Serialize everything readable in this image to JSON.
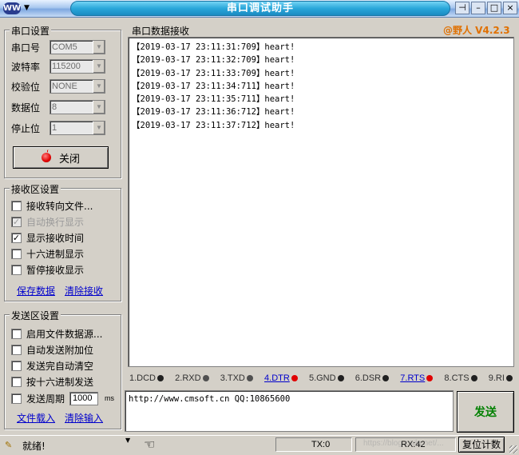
{
  "window": {
    "logo_text": "WW",
    "title": "串口调试助手",
    "buttons": {
      "pin": "⊣",
      "minimize": "–",
      "maximize": "□",
      "close": "×"
    }
  },
  "serial_settings": {
    "group_title": "串口设置",
    "fields": [
      {
        "label": "串口号",
        "value": "COM5"
      },
      {
        "label": "波特率",
        "value": "115200"
      },
      {
        "label": "校验位",
        "value": "NONE"
      },
      {
        "label": "数据位",
        "value": "8"
      },
      {
        "label": "停止位",
        "value": "1"
      }
    ],
    "close_button": "关闭"
  },
  "recv_settings": {
    "group_title": "接收区设置",
    "options": [
      {
        "label": "接收转向文件...",
        "checked": false,
        "disabled": false
      },
      {
        "label": "自动换行显示",
        "checked": true,
        "disabled": true
      },
      {
        "label": "显示接收时间",
        "checked": true,
        "disabled": false
      },
      {
        "label": "十六进制显示",
        "checked": false,
        "disabled": false
      },
      {
        "label": "暂停接收显示",
        "checked": false,
        "disabled": false
      }
    ],
    "save_link": "保存数据",
    "clear_link": "清除接收"
  },
  "send_settings": {
    "group_title": "发送区设置",
    "options": [
      {
        "label": "启用文件数据源...",
        "checked": false
      },
      {
        "label": "自动发送附加位",
        "checked": false
      },
      {
        "label": "发送完自动清空",
        "checked": false
      },
      {
        "label": "按十六进制发送",
        "checked": false
      }
    ],
    "period_label": "发送周期",
    "period_value": "1000",
    "period_unit": "ms",
    "load_link": "文件载入",
    "clear_link": "清除输入"
  },
  "receive": {
    "title": "串口数据接收",
    "version": "@野人 V4.2.3",
    "lines": [
      "【2019-03-17 23:11:31:709】heart!",
      "【2019-03-17 23:11:32:709】heart!",
      "【2019-03-17 23:11:33:709】heart!",
      "【2019-03-17 23:11:34:711】heart!",
      "【2019-03-17 23:11:35:711】heart!",
      "【2019-03-17 23:11:36:712】heart!",
      "【2019-03-17 23:11:37:712】heart!"
    ]
  },
  "signals": [
    {
      "label": "1.DCD",
      "led": "black",
      "link": false
    },
    {
      "label": "2.RXD",
      "led": "gray",
      "link": false
    },
    {
      "label": "3.TXD",
      "led": "gray",
      "link": false
    },
    {
      "label": "4.DTR",
      "led": "red",
      "link": true
    },
    {
      "label": "5.GND",
      "led": "black",
      "link": false
    },
    {
      "label": "6.DSR",
      "led": "black",
      "link": false
    },
    {
      "label": "7.RTS",
      "led": "red",
      "link": true
    },
    {
      "label": "8.CTS",
      "led": "black",
      "link": false
    },
    {
      "label": "9.RI",
      "led": "black",
      "link": false
    }
  ],
  "send": {
    "text": "http://www.cmsoft.cn QQ:10865600",
    "button": "发送"
  },
  "status": {
    "text": "就绪!",
    "tx": "TX:0",
    "rx": "RX:42",
    "reset_button": "复位计数",
    "watermark": "https://blog.csdn.net/..."
  },
  "colors": {
    "accent_title": "#2aa7da",
    "version": "#e07000",
    "send_button": "#008000",
    "led_on": "#e00000"
  }
}
